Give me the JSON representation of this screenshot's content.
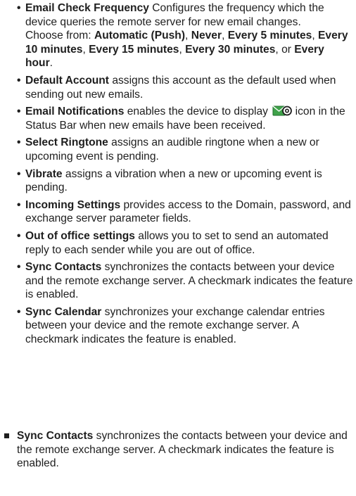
{
  "items": [
    {
      "term": "Email Check Frequency",
      "text": " Configures the frequency which the device queries the remote server for new email changes.",
      "choose_prefix": "Choose from: ",
      "options": [
        "Automatic (Push)",
        "Never",
        "Every 5 minutes",
        "Every 10 minutes",
        "Every 15 minutes",
        "Every 30 minutes"
      ],
      "last_option_joiner": ", or ",
      "last_option": "Every hour",
      "end": "."
    },
    {
      "term": "Default Account",
      "text": " assigns this account as the default used when sending out new emails."
    },
    {
      "term": "Email Notifications",
      "text_before_icon": " enables the device to display ",
      "icon": "email-notification-icon",
      "text_after_icon": " icon in the Status Bar when new emails have been received."
    },
    {
      "term": "Select Ringtone",
      "text": " assigns an audible ringtone when a new or upcoming event is pending."
    },
    {
      "term": "Vibrate",
      "text": " assigns a vibration when a new or upcoming event is pending."
    },
    {
      "term": "Incoming Settings",
      "text": " provides access to the Domain, password, and exchange server parameter fields."
    },
    {
      "term": "Out of office settings",
      "text": " allows you to set to send an automated reply to each sender while you are out of office."
    },
    {
      "term": "Sync Contacts",
      "text": " synchronizes the contacts between your device and the remote exchange server. A checkmark indicates the feature is enabled."
    },
    {
      "term": "Sync Calendar",
      "text": " synchronizes your exchange calendar entries between your device and the remote exchange server. A checkmark indicates the feature is enabled."
    }
  ],
  "top_item": {
    "term": "Sync Contacts",
    "text": " synchronizes the contacts between your device and the remote exchange server. A checkmark indicates the feature is enabled."
  },
  "colors": {
    "text": "#1e1e1e",
    "icon_green": "#2e8b3a"
  }
}
